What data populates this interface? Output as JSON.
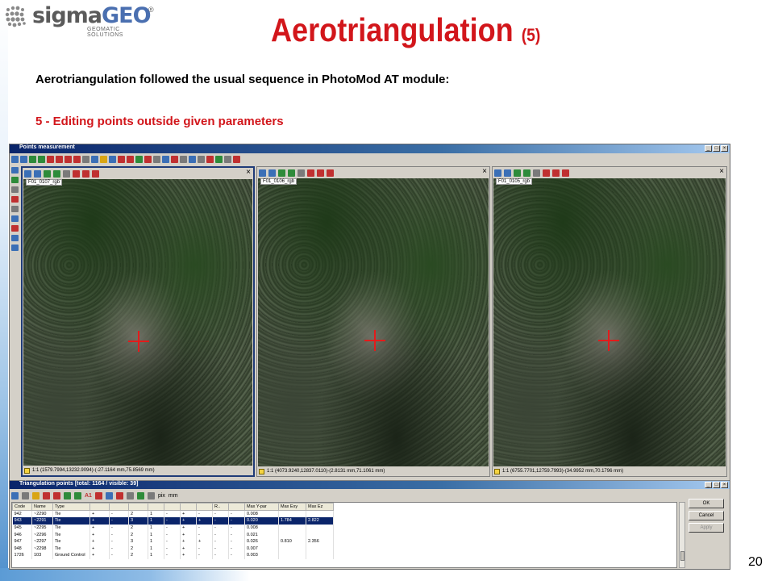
{
  "logo": {
    "brand_a": "sigma",
    "brand_b": "GEO",
    "registered": "®",
    "tagline": "GEOMATIC SOLUTIONS"
  },
  "slide": {
    "title": "Aerotriangulation",
    "title_num": "(5)",
    "subtitle": "Aerotriangulation followed the usual sequence in PhotoMod AT module:",
    "step": "5 - Editing points outside given parameters",
    "page_number": "20",
    "colors": {
      "accent": "#d2161b",
      "brand_blue": "#4a6fb0"
    }
  },
  "app": {
    "window_title": "Points measurement",
    "panes": [
      {
        "label": "F01_0107_rgb",
        "status": "1:1 (1579.7994,13232.9094)-(-27.1164 mm,75.8569 mm)"
      },
      {
        "label": "F01_0106_rgb",
        "status": "1:1 (4073.9240,12837.0110)-(2.8131 mm,71.1061 mm)"
      },
      {
        "label": "F01_0105_rgb",
        "status": "1:1 (6755.7701,12759.7993)-(34.9952 mm,70.1796 mm)"
      }
    ]
  },
  "triangulation": {
    "title": "Triangulation points [total: 1164 / visible: 39]",
    "units": [
      "pix",
      "mm"
    ],
    "tool_a1": "A1",
    "columns": [
      "Code",
      "Name",
      "Type",
      "",
      "",
      "",
      "",
      "",
      "",
      "",
      "R..",
      "Max Y-par",
      "Max Exy",
      "Max Ez"
    ],
    "rows": [
      [
        "942",
        "~2290",
        "Tie",
        "+",
        "-",
        "2",
        "1",
        "-",
        "+",
        "-",
        "-",
        "-",
        "0.008",
        "",
        ""
      ],
      [
        "943",
        "~2291",
        "Tie",
        "+",
        "-",
        "3",
        "1",
        "-",
        "+",
        "+",
        "-",
        "-",
        "0.020",
        "1.784",
        "2.822"
      ],
      [
        "945",
        "~2295",
        "Tie",
        "+",
        "-",
        "2",
        "1",
        "-",
        "+",
        "-",
        "-",
        "-",
        "0.008",
        "",
        ""
      ],
      [
        "946",
        "~2296",
        "Tie",
        "+",
        "-",
        "2",
        "1",
        "-",
        "+",
        "-",
        "-",
        "-",
        "0.021",
        "",
        ""
      ],
      [
        "947",
        "~2297",
        "Tie",
        "+",
        "-",
        "3",
        "1",
        "-",
        "+",
        "+",
        "-",
        "-",
        "0.026",
        "0.810",
        "2.356"
      ],
      [
        "948",
        "~2298",
        "Tie",
        "+",
        "-",
        "2",
        "1",
        "-",
        "+",
        "-",
        "-",
        "-",
        "0.007",
        "",
        ""
      ],
      [
        "1726",
        "103",
        "Ground Control",
        "+",
        "-",
        "2",
        "1",
        "-",
        "+",
        "-",
        "-",
        "-",
        "0.003",
        "",
        ""
      ]
    ],
    "selected_row": 1,
    "buttons": {
      "ok": "OK",
      "cancel": "Cancel",
      "apply": "Apply"
    }
  }
}
